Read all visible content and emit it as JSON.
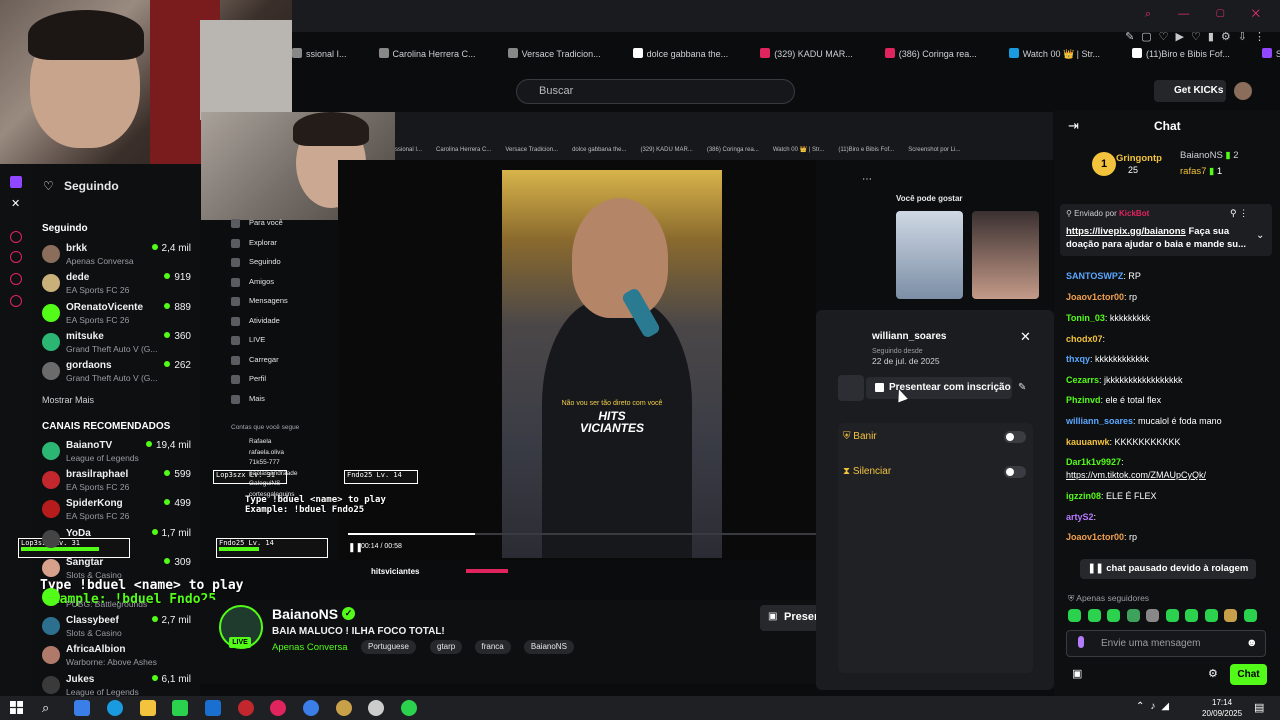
{
  "browser": {
    "bookmarks": [
      "ssional I...",
      "Carolina Herrera C...",
      "Versace Tradicion...",
      "dolce gabbana the...",
      "(329) KADU MAR...",
      "(386) Coringa rea...",
      "Watch 00 👑 | Str...",
      "(11)Biro e Bibis Fof...",
      "Screenshot por Li..."
    ]
  },
  "header": {
    "search_placeholder": "Buscar",
    "get_kicks": "Get KICKs"
  },
  "sidebar": {
    "title": "Seguindo",
    "section_following": "Seguindo",
    "following": [
      {
        "name": "brkk",
        "game": "Apenas Conversa",
        "count": "2,4 mil",
        "color": "#8a6d5a"
      },
      {
        "name": "dede",
        "game": "EA Sports FC 26",
        "count": "919",
        "color": "#c9b07a"
      },
      {
        "name": "ORenatoVicente",
        "game": "EA Sports FC 26",
        "count": "889",
        "color": "#53fc18"
      },
      {
        "name": "mitsuke",
        "game": "Grand Theft Auto V (G...",
        "count": "360",
        "color": "#2bb673"
      },
      {
        "name": "gordaons",
        "game": "Grand Theft Auto V (G...",
        "count": "262",
        "color": "#6b6b6b"
      }
    ],
    "show_more": "Mostrar Mais",
    "section_recommended": "CANAIS RECOMENDADOS",
    "recommended": [
      {
        "name": "BaianoTV",
        "game": "League of Legends",
        "count": "19,4 mil",
        "color": "#2bb673"
      },
      {
        "name": "brasilraphael",
        "game": "EA Sports FC 26",
        "count": "599",
        "color": "#c1272d"
      },
      {
        "name": "SpiderKong",
        "game": "EA Sports FC 26",
        "count": "499",
        "color": "#b71c1c"
      },
      {
        "name": "YoDa",
        "game": "",
        "count": "1,7 mil",
        "color": "#444"
      },
      {
        "name": "Sangtar",
        "game": "Slots & Casino",
        "count": "309",
        "color": "#d7a08a"
      },
      {
        "name": "",
        "game": "PUBG: Battlegrounds",
        "count": "",
        "color": "#53fc18"
      },
      {
        "name": "Classybeef",
        "game": "Slots & Casino",
        "count": "2,7 mil",
        "color": "#2d6f8f"
      },
      {
        "name": "AfricaAlbion",
        "game": "Warborne: Above Ashes",
        "count": "",
        "color": "#b07a6a"
      },
      {
        "name": "Jukes",
        "game": "League of Legends",
        "count": "6,1 mil",
        "color": "#3a3a3a"
      }
    ]
  },
  "nested": {
    "menu": [
      "Para você",
      "Explorar",
      "Seguindo",
      "Amigos",
      "Mensagens",
      "Atividade",
      "LIVE",
      "Carregar",
      "Perfil",
      "Mais"
    ],
    "accounts_label": "Contas que você segue",
    "accounts": [
      "Rafaela",
      "rafaela.oliva",
      "71k55-777",
      "paolas.andraade",
      "GaleguiNS",
      "cortesgaleguins"
    ],
    "video_caption": "Não vou ser tão direto com você",
    "video_logo_1": "HITS",
    "video_logo_2": "VICIANTES",
    "video_time": "00:14 / 00:58",
    "suggest_title": "Você pode gostar",
    "handle": "hitsviciantes"
  },
  "overlay": {
    "type_cmd": "Type !bduel <name> to play",
    "example": "Example: !bduel Fndo25",
    "player1": "Lop3szx",
    "player1_lv": "Lv. 31",
    "player2": "Fndo25",
    "player2_lv": "Lv. 14"
  },
  "stream": {
    "name": "BaianoNS",
    "title": "BAIA MALUCO ! ILHA FOCO TOTAL!",
    "category": "Apenas Conversa",
    "tags": [
      "Portuguese",
      "gtarp",
      "franca",
      "BaianoNS"
    ],
    "live": "LIVE",
    "present_button": "Presen"
  },
  "popup": {
    "username": "williann_soares",
    "since_label": "Seguindo desde",
    "since_date": "22 de jul. de 2025",
    "gift_button": "Presentear com inscrição",
    "ban": "Banir",
    "silence": "Silenciar"
  },
  "chat": {
    "title": "Chat",
    "top_gifters": [
      {
        "rank": "1",
        "name": "Gringontp",
        "count": "25"
      },
      {
        "name": "BaianoNS",
        "count": "2"
      },
      {
        "name": "rafas7",
        "count": "1"
      }
    ],
    "pinned_by": "Enviado por",
    "pinned_bot": "KickBot",
    "pinned_link": "https://livepix.gg/baianons",
    "pinned_text": "Faça sua doação para ajudar o baia e mande su...",
    "messages": [
      {
        "user": "SANTOSWPZ",
        "text": "RP",
        "color": "#5aa7ff"
      },
      {
        "user": "Joaov1ctor00",
        "text": "rp",
        "color": "#f0a04b"
      },
      {
        "user": "Tonin_03",
        "text": "kkkkkkkkk",
        "color": "#53fc18"
      },
      {
        "user": "chodx07",
        "text": "",
        "color": "#f3c33e"
      },
      {
        "user": "thxqy",
        "text": "kkkkkkkkkkkk",
        "color": "#5aa7ff"
      },
      {
        "user": "Cezarrs",
        "text": "jkkkkkkkkkkkkkkkkk",
        "color": "#53fc18"
      },
      {
        "user": "Phzinvd",
        "text": "ele é total flex",
        "color": "#53fc18"
      },
      {
        "user": "williann_soares",
        "text": "mucalol é foda mano",
        "color": "#5aa7ff"
      },
      {
        "user": "kauuanwk",
        "text": "KKKKKKKKKKK",
        "color": "#f3c33e"
      },
      {
        "user": "Dar1k1v9927",
        "text": "",
        "color": "#53fc18"
      },
      {
        "user": "",
        "text": "https://vm.tiktok.com/ZMAUpCyQk/",
        "color": "#fff"
      },
      {
        "user": "igzzin08",
        "text": "ELE É FLEX",
        "color": "#53fc18"
      },
      {
        "user": "artyS2",
        "text": "",
        "color": "#b57bff"
      },
      {
        "user": "Joaov1ctor00",
        "text": "rp",
        "color": "#f0a04b"
      }
    ],
    "paused": "chat pausado devido à rolagem",
    "followers_only": "Apenas seguidores",
    "input_placeholder": "Envie uma mensagem",
    "send": "Chat"
  },
  "taskbar": {
    "time": "17:14",
    "date": "20/09/2025"
  }
}
